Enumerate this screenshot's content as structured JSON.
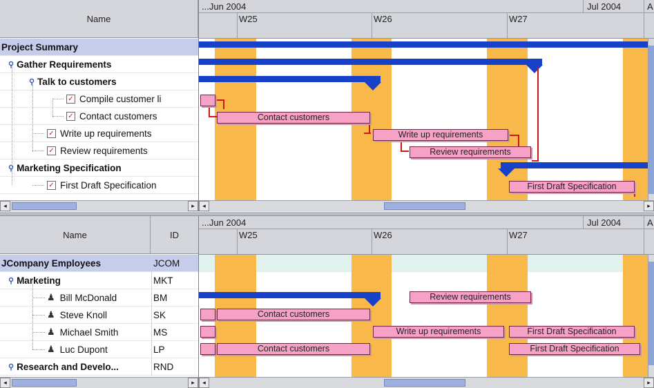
{
  "timeline": {
    "month1": "...Jun 2004",
    "month2": "Jul 2004",
    "month3_cut": "A",
    "weeks": [
      "W25",
      "W26",
      "W27"
    ]
  },
  "pane1": {
    "header": {
      "name": "Name"
    },
    "rows": [
      {
        "label": "Project Summary"
      },
      {
        "label": "Gather Requirements"
      },
      {
        "label": "Talk to customers"
      },
      {
        "label": "Compile customer li"
      },
      {
        "label": "Contact customers"
      },
      {
        "label": "Write up requirements"
      },
      {
        "label": "Review requirements"
      },
      {
        "label": "Marketing Specification"
      },
      {
        "label": "First Draft Specification"
      }
    ],
    "tasks": {
      "contact": "Contact customers",
      "writeup": "Write up requirements",
      "review": "Review requirements",
      "firstdraft": "First Draft Specification"
    }
  },
  "pane2": {
    "header": {
      "name": "Name",
      "id": "ID"
    },
    "rows": [
      {
        "label": "JCompany Employees",
        "id": "JCOM"
      },
      {
        "label": "Marketing",
        "id": "MKT"
      },
      {
        "label": "Bill McDonald",
        "id": "BM"
      },
      {
        "label": "Steve Knoll",
        "id": "SK"
      },
      {
        "label": "Michael Smith",
        "id": "MS"
      },
      {
        "label": "Luc Dupont",
        "id": "LP"
      },
      {
        "label": "Research and Develo...",
        "id": "RND"
      }
    ],
    "tasks": {
      "review": "Review requirements",
      "contact1": "Contact customers",
      "writeup": "Write up requirements",
      "firstdraft1": "First Draft Specification",
      "contact2": "Contact customers",
      "firstdraft2": "First Draft Specification"
    }
  },
  "icons": {
    "scroll_left": "◂",
    "scroll_right": "▸",
    "expand": "expand-pin-icon",
    "checkbox": "task-checkbox-icon",
    "person": "person-icon"
  },
  "colors": {
    "weekend": "#f8b84a",
    "summary_bar": "#1741c9",
    "task_bar": "#f6a1c6",
    "dependency": "#d01818",
    "selected_row": "#c6cdeb"
  }
}
